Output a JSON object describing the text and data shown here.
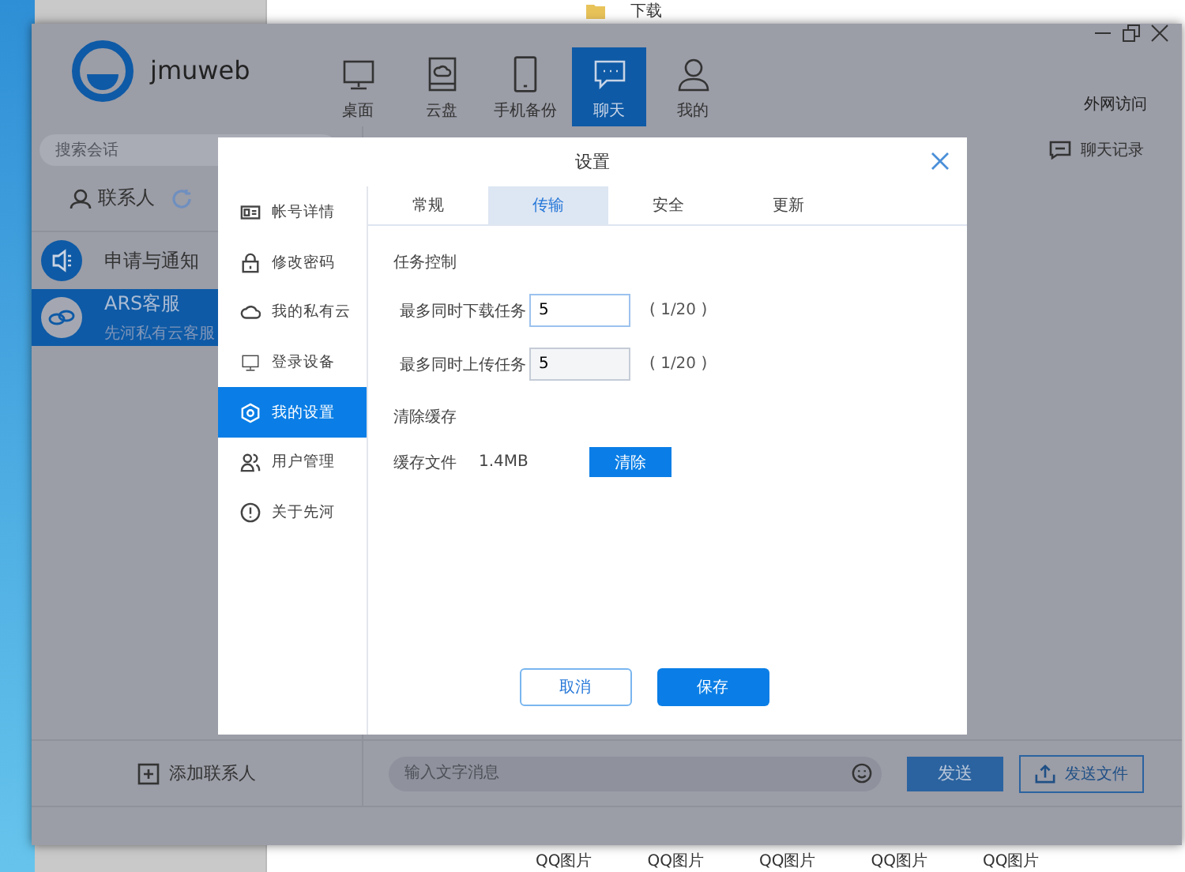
{
  "background_window": {
    "top_item": "下载",
    "thumbnail_labels": [
      "QQ图片",
      "QQ图片",
      "QQ图片",
      "QQ图片",
      "QQ图片"
    ]
  },
  "app": {
    "username": "jmuweb",
    "nav": [
      {
        "label": "桌面",
        "selected": false
      },
      {
        "label": "云盘",
        "selected": false
      },
      {
        "label": "手机备份",
        "selected": false
      },
      {
        "label": "聊天",
        "selected": true
      },
      {
        "label": "我的",
        "selected": false
      }
    ],
    "external_access": "外网访问",
    "search": {
      "placeholder": "搜索会话"
    },
    "contacts_tab": "联系人",
    "conversations": [
      {
        "title": "申请与通知",
        "selected": false
      },
      {
        "title": "ARS客服",
        "subtitle": "先河私有云客服",
        "selected": true
      }
    ],
    "chat_history": "聊天记录",
    "add_contact": "添加联系人",
    "message_input": {
      "placeholder": "输入文字消息"
    },
    "send": "发送",
    "send_file": "发送文件"
  },
  "dialog": {
    "title": "设置",
    "menu": [
      {
        "label": "帐号详情",
        "selected": false
      },
      {
        "label": "修改密码",
        "selected": false
      },
      {
        "label": "我的私有云",
        "selected": false
      },
      {
        "label": "登录设备",
        "selected": false
      },
      {
        "label": "我的设置",
        "selected": true
      },
      {
        "label": "用户管理",
        "selected": false
      },
      {
        "label": "关于先河",
        "selected": false
      }
    ],
    "tabs": [
      {
        "label": "常规",
        "selected": false
      },
      {
        "label": "传输",
        "selected": true
      },
      {
        "label": "安全",
        "selected": false
      },
      {
        "label": "更新",
        "selected": false
      }
    ],
    "task_section": "任务控制",
    "task_rows": [
      {
        "label": "最多同时下载任务",
        "value": "5",
        "range": "( 1/20 )",
        "focused": true
      },
      {
        "label": "最多同时上传任务",
        "value": "5",
        "range": "( 1/20 )",
        "focused": false
      }
    ],
    "cache_section": "清除缓存",
    "cache": {
      "label": "缓存文件",
      "size": "1.4MB",
      "button": "清除"
    },
    "cancel": "取消",
    "save": "保存"
  }
}
